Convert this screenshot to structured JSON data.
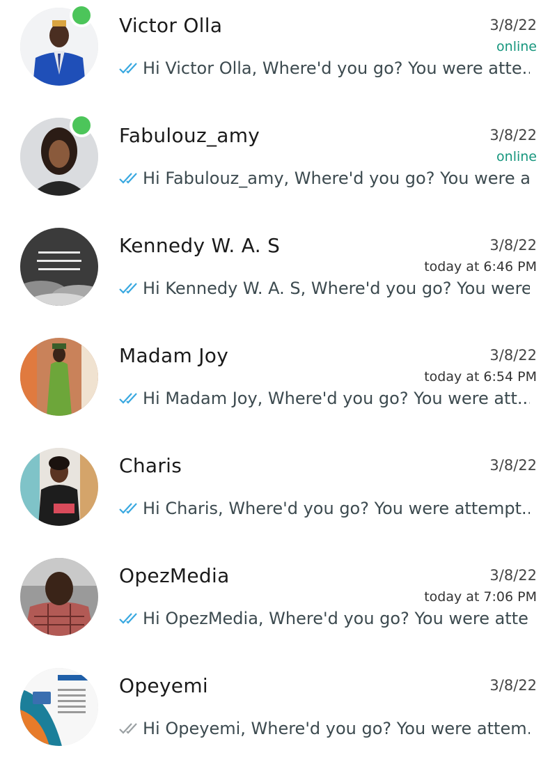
{
  "chats": [
    {
      "name": "Victor Olla",
      "date": "3/8/22",
      "status": "online",
      "preview": "Hi Victor Olla,  Where'd you go? You were atte...",
      "online": true,
      "tick_color": "#38a8e0",
      "avatar": "man-blue-suit"
    },
    {
      "name": "Fabulouz_amy",
      "date": "3/8/22",
      "status": "online",
      "preview": "Hi Fabulouz_amy,  Where'd you go? You were a...",
      "online": true,
      "tick_color": "#38a8e0",
      "avatar": "woman-portrait"
    },
    {
      "name": "Kennedy W. A. S",
      "date": "3/8/22",
      "status": "today at 6:46 PM",
      "preview": "Hi Kennedy W. A. S,  Where'd you go? You were...",
      "online": false,
      "tick_color": "#38a8e0",
      "avatar": "quote-clouds"
    },
    {
      "name": "Madam Joy",
      "date": "3/8/22",
      "status": "today at 6:54 PM",
      "preview": "Hi Madam Joy,  Where'd you go? You were att...",
      "online": false,
      "tick_color": "#38a8e0",
      "avatar": "woman-green-dress"
    },
    {
      "name": "Charis",
      "date": "3/8/22",
      "status": "",
      "preview": "Hi Charis,  Where'd you go? You were attempt...",
      "online": false,
      "tick_color": "#38a8e0",
      "avatar": "woman-black-outfit"
    },
    {
      "name": "OpezMedia",
      "date": "3/8/22",
      "status": "today at 7:06 PM",
      "preview": "Hi OpezMedia,  Where'd you go? You were atte...",
      "online": false,
      "tick_color": "#38a8e0",
      "avatar": "man-plaid-shirt"
    },
    {
      "name": "Opeyemi",
      "date": "3/8/22",
      "status": "",
      "preview": "Hi Opeyemi,  Where'd you go? You were attem...",
      "online": false,
      "tick_color": "#9aa0a3",
      "avatar": "gigabytes-flyer"
    }
  ]
}
